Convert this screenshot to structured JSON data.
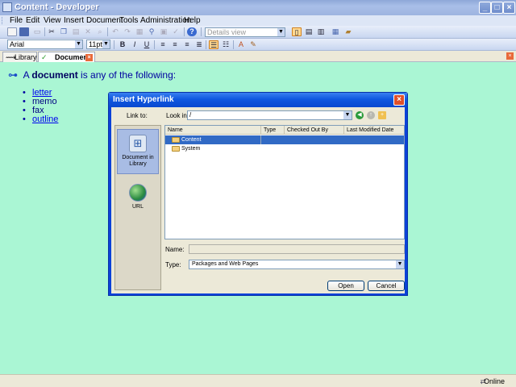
{
  "window": {
    "title": "Content - Developer"
  },
  "menu": [
    "File",
    "Edit",
    "View",
    "Insert",
    "Document",
    "Tools",
    "Administration",
    "Help"
  ],
  "toolbar": {
    "view_combo": "Details view",
    "font_combo": "Arial",
    "size_combo": "11pt",
    "bold": "B",
    "italic": "I",
    "underline": "U"
  },
  "tabs": [
    {
      "label": "Library"
    },
    {
      "label": "Document"
    }
  ],
  "document": {
    "intro_prefix": "A",
    "intro_term": "document",
    "intro_suffix": "is any of the following:",
    "items": [
      {
        "text": "letter",
        "link": true
      },
      {
        "text": "memo",
        "link": false
      },
      {
        "text": "fax",
        "link": false
      },
      {
        "text": "outline",
        "link": true
      }
    ]
  },
  "dialog": {
    "title": "Insert Hyperlink",
    "link_to_label": "Link to:",
    "look_in_label": "Look in:",
    "look_in_value": "/",
    "places": [
      {
        "label": "Document in Library",
        "selected": true
      },
      {
        "label": "URL",
        "selected": false
      }
    ],
    "columns": [
      "Name",
      "Type",
      "Checked Out By",
      "Last Modified Date"
    ],
    "files": [
      {
        "name": "Content",
        "selected": true
      },
      {
        "name": "System",
        "selected": false
      }
    ],
    "name_label": "Name:",
    "name_value": "",
    "type_label": "Type:",
    "type_value": "Packages and Web Pages",
    "open_button": "Open",
    "cancel_button": "Cancel"
  },
  "status": {
    "online": "Online"
  }
}
